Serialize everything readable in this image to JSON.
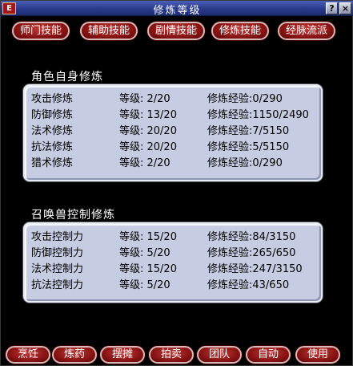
{
  "window": {
    "title": "修炼等级",
    "icon_glyph": "E",
    "help_glyph": "?",
    "close_glyph": "×"
  },
  "tabs": [
    {
      "label": "师门技能"
    },
    {
      "label": "辅助技能"
    },
    {
      "label": "剧情技能"
    },
    {
      "label": "修炼技能"
    },
    {
      "label": "经脉流派"
    }
  ],
  "role_section": {
    "title": "角色自身修炼",
    "rows": [
      {
        "name": "攻击修炼",
        "level": "等级: 2/20",
        "exp": "修炼经验:0/290"
      },
      {
        "name": "防御修炼",
        "level": "等级: 13/20",
        "exp": "修炼经验:1150/2490"
      },
      {
        "name": "法术修炼",
        "level": "等级: 20/20",
        "exp": "修炼经验:7/5150"
      },
      {
        "name": "抗法修炼",
        "level": "等级: 20/20",
        "exp": "修炼经验:5/5150"
      },
      {
        "name": "猎术修炼",
        "level": "等级: 2/20",
        "exp": "修炼经验:0/290"
      }
    ]
  },
  "pet_section": {
    "title": "召唤兽控制修炼",
    "rows": [
      {
        "name": "攻击控制力",
        "level": "等级: 15/20",
        "exp": "修炼经验:84/3150"
      },
      {
        "name": "防御控制力",
        "level": "等级: 5/20",
        "exp": "修炼经验:265/650"
      },
      {
        "name": "法术控制力",
        "level": "等级: 15/20",
        "exp": "修炼经验:247/3150"
      },
      {
        "name": "抗法控制力",
        "level": "等级: 5/20",
        "exp": "修炼经验:43/650"
      }
    ]
  },
  "bottom_buttons": [
    {
      "label": "烹饪"
    },
    {
      "label": "炼药"
    },
    {
      "label": "摆摊"
    },
    {
      "label": "拍卖"
    },
    {
      "label": "团队"
    },
    {
      "label": "自动"
    },
    {
      "label": "使用"
    }
  ],
  "colors": {
    "tab_fill": "#8a1414",
    "panel_fill": "#c6cde2",
    "titlebar": "#2a3a8c"
  }
}
